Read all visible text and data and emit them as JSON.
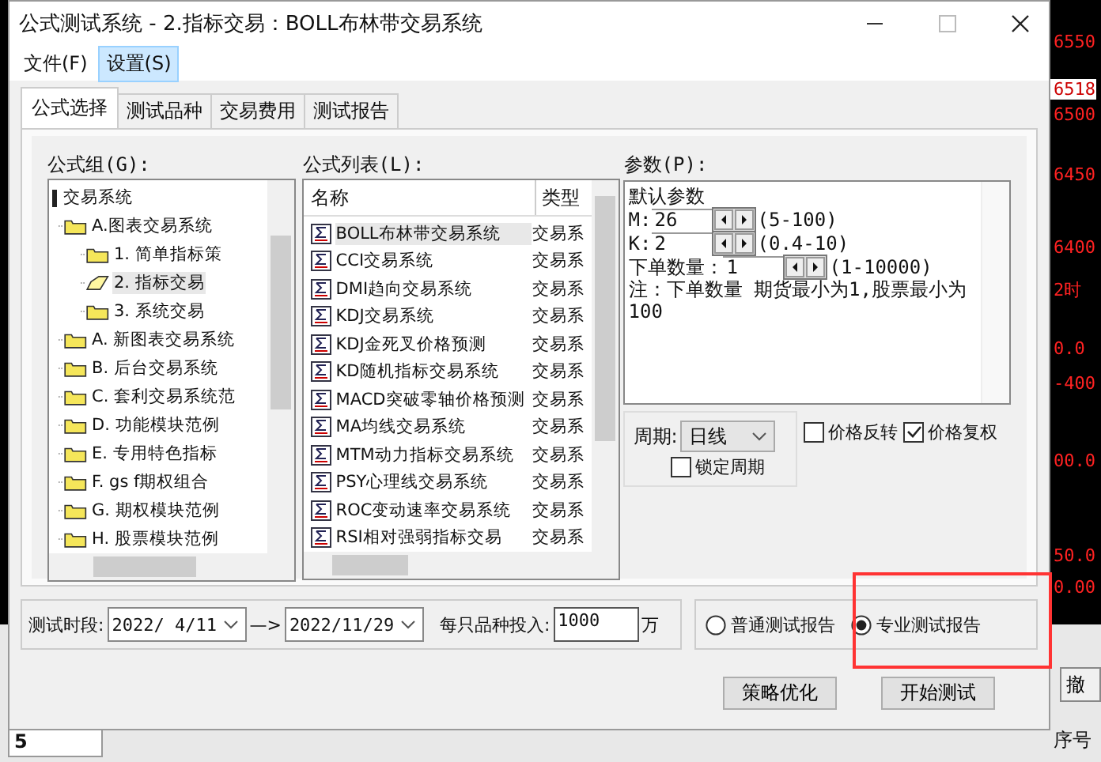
{
  "window": {
    "title": "公式测试系统 - 2.指标交易：BOLL布林带交易系统"
  },
  "menu": [
    {
      "label": "文件(F)",
      "selected": false
    },
    {
      "label": "设置(S)",
      "selected": true
    }
  ],
  "tabs": [
    {
      "label": "公式选择",
      "selected": true
    },
    {
      "label": "测试品种",
      "selected": false
    },
    {
      "label": "交易费用",
      "selected": false
    },
    {
      "label": "测试报告",
      "selected": false
    }
  ],
  "formula_group": {
    "label": "公式组(G):",
    "tree": [
      {
        "label": "交易系统",
        "selected": false,
        "children": [
          {
            "label": "A.图表交易系统",
            "selected": false,
            "children": [
              {
                "label": "1. 简单指标策",
                "selected": false
              },
              {
                "label": "2. 指标交易",
                "selected": true
              },
              {
                "label": "3. 系统交易",
                "selected": false
              }
            ]
          },
          {
            "label": "A. 新图表交易系统",
            "selected": false
          },
          {
            "label": "B. 后台交易系统",
            "selected": false
          },
          {
            "label": "C. 套利交易系统范",
            "selected": false
          },
          {
            "label": "D. 功能模块范例",
            "selected": false
          },
          {
            "label": "E. 专用特色指标",
            "selected": false
          },
          {
            "label": "F. gs f期权组合",
            "selected": false
          },
          {
            "label": "G. 期权模块范例",
            "selected": false
          },
          {
            "label": "H. 股票模块范例",
            "selected": false
          }
        ]
      }
    ]
  },
  "formula_list": {
    "label": "公式列表(L):",
    "columns": [
      "名称",
      "类型"
    ],
    "rows": [
      {
        "name": "BOLL布林带交易系统",
        "type": "交易系",
        "selected": true
      },
      {
        "name": "CCI交易系统",
        "type": "交易系",
        "selected": false
      },
      {
        "name": "DMI趋向交易系统",
        "type": "交易系",
        "selected": false
      },
      {
        "name": "KDJ交易系统",
        "type": "交易系",
        "selected": false
      },
      {
        "name": "KDJ金死叉价格预测",
        "type": "交易系",
        "selected": false
      },
      {
        "name": "KD随机指标交易系统",
        "type": "交易系",
        "selected": false
      },
      {
        "name": "MACD突破零轴价格预测",
        "type": "交易系",
        "selected": false
      },
      {
        "name": "MA均线交易系统",
        "type": "交易系",
        "selected": false
      },
      {
        "name": "MTM动力指标交易系统",
        "type": "交易系",
        "selected": false
      },
      {
        "name": "PSY心理线交易系统",
        "type": "交易系",
        "selected": false
      },
      {
        "name": "ROC变动速率交易系统",
        "type": "交易系",
        "selected": false
      },
      {
        "name": "RSI相对强弱指标交易",
        "type": "交易系",
        "selected": false
      }
    ]
  },
  "params": {
    "label": "参数(P):",
    "heading": "默认参数",
    "fields": [
      {
        "label": "M:",
        "value": "26",
        "range": "(5-100)"
      },
      {
        "label": "K:",
        "value": "2",
        "range": "(0.4-10)"
      },
      {
        "label": "下单数量：",
        "value": "1",
        "range": "(1-10000)"
      }
    ],
    "note": "注：下单数量 期货最小为1,股票最小为100"
  },
  "period": {
    "label": "周期:",
    "value": "日线",
    "lock": {
      "label": "锁定周期",
      "checked": false
    }
  },
  "options": [
    {
      "label": "价格反转",
      "checked": false
    },
    {
      "label": "价格复权",
      "checked": true
    }
  ],
  "test_range": {
    "label": "测试时段:",
    "start": "2022/ 4/11",
    "arrow": "—>",
    "end": "2022/11/29",
    "invest_label": "每只品种投入:",
    "invest_value": "1000",
    "unit": "万"
  },
  "report": [
    {
      "label": "普通测试报告",
      "selected": false
    },
    {
      "label": "专业测试报告",
      "selected": true
    }
  ],
  "buttons": [
    "策略优化",
    "开始测试"
  ],
  "background": {
    "price_labels": [
      {
        "text": "6550",
        "boxed": false
      },
      {
        "text": "6518",
        "boxed": true
      },
      {
        "text": "6500",
        "boxed": false
      },
      {
        "text": "6450",
        "boxed": false
      },
      {
        "text": "6400",
        "boxed": false
      },
      {
        "text": "2时",
        "boxed": false
      },
      {
        "text": "0.0",
        "boxed": false
      },
      {
        "text": "-400",
        "boxed": false
      },
      {
        "text": "00.0",
        "boxed": false
      },
      {
        "text": "50.0",
        "boxed": false
      },
      {
        "text": "0.00",
        "boxed": false
      }
    ],
    "cancel_button": "撤",
    "column": "序号",
    "field_value": "5"
  }
}
